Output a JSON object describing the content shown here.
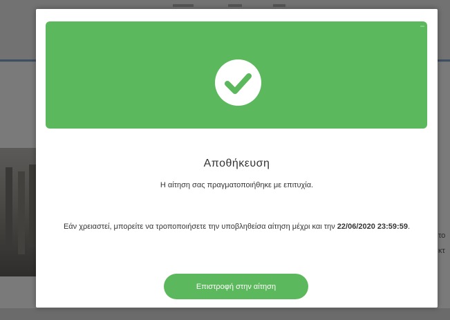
{
  "modal": {
    "icon": "check-circle-icon",
    "title": "Αποθήκευση",
    "subtitle": "Η αίτηση σας πραγματοποιήθηκε με επιτυχία.",
    "info_text": "Εάν χρειαστεί, μπορείτε να τροποποιήσετε την υποβληθείσα αίτηση μέχρι και την",
    "deadline": "22/06/2020 23:59:59",
    "info_end": ".",
    "return_button_label": "Επιστροφή στην αίτηση"
  },
  "background": {
    "right_text_1": "το",
    "right_text_2": "κτ"
  },
  "colors": {
    "success_green": "#5cb85c",
    "overlay": "#7a7a7a",
    "text": "#333333"
  }
}
